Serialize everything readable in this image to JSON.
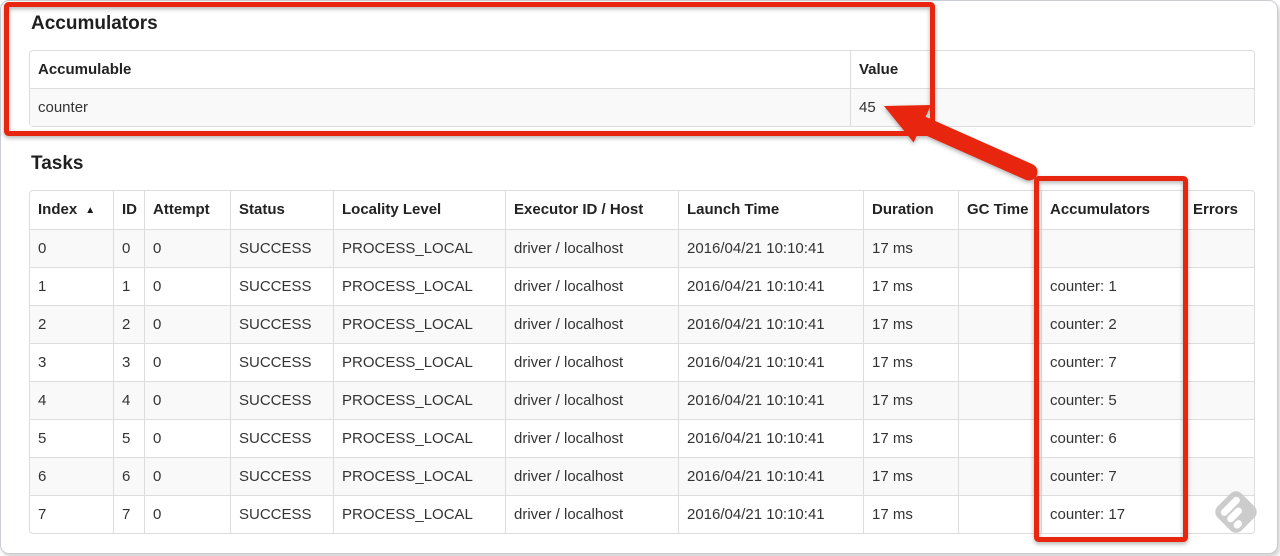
{
  "accumulators": {
    "title": "Accumulators",
    "columns": [
      {
        "label": "Accumulable"
      },
      {
        "label": "Value"
      }
    ],
    "rows": [
      {
        "accumulable": "counter",
        "value": "45"
      }
    ]
  },
  "tasks": {
    "title": "Tasks",
    "columns": [
      {
        "label": "Index",
        "sorted": "ascending"
      },
      {
        "label": "ID"
      },
      {
        "label": "Attempt"
      },
      {
        "label": "Status"
      },
      {
        "label": "Locality Level"
      },
      {
        "label": "Executor ID / Host"
      },
      {
        "label": "Launch Time"
      },
      {
        "label": "Duration"
      },
      {
        "label": "GC Time"
      },
      {
        "label": "Accumulators"
      },
      {
        "label": "Errors"
      }
    ],
    "rows": [
      {
        "index": "0",
        "id": "0",
        "attempt": "0",
        "status": "SUCCESS",
        "locality_level": "PROCESS_LOCAL",
        "executor_id_host": "driver / localhost",
        "launch_time": "2016/04/21 10:10:41",
        "duration": "17 ms",
        "gc_time": "",
        "accumulators": "",
        "errors": ""
      },
      {
        "index": "1",
        "id": "1",
        "attempt": "0",
        "status": "SUCCESS",
        "locality_level": "PROCESS_LOCAL",
        "executor_id_host": "driver / localhost",
        "launch_time": "2016/04/21 10:10:41",
        "duration": "17 ms",
        "gc_time": "",
        "accumulators": "counter: 1",
        "errors": ""
      },
      {
        "index": "2",
        "id": "2",
        "attempt": "0",
        "status": "SUCCESS",
        "locality_level": "PROCESS_LOCAL",
        "executor_id_host": "driver / localhost",
        "launch_time": "2016/04/21 10:10:41",
        "duration": "17 ms",
        "gc_time": "",
        "accumulators": "counter: 2",
        "errors": ""
      },
      {
        "index": "3",
        "id": "3",
        "attempt": "0",
        "status": "SUCCESS",
        "locality_level": "PROCESS_LOCAL",
        "executor_id_host": "driver / localhost",
        "launch_time": "2016/04/21 10:10:41",
        "duration": "17 ms",
        "gc_time": "",
        "accumulators": "counter: 7",
        "errors": ""
      },
      {
        "index": "4",
        "id": "4",
        "attempt": "0",
        "status": "SUCCESS",
        "locality_level": "PROCESS_LOCAL",
        "executor_id_host": "driver / localhost",
        "launch_time": "2016/04/21 10:10:41",
        "duration": "17 ms",
        "gc_time": "",
        "accumulators": "counter: 5",
        "errors": ""
      },
      {
        "index": "5",
        "id": "5",
        "attempt": "0",
        "status": "SUCCESS",
        "locality_level": "PROCESS_LOCAL",
        "executor_id_host": "driver / localhost",
        "launch_time": "2016/04/21 10:10:41",
        "duration": "17 ms",
        "gc_time": "",
        "accumulators": "counter: 6",
        "errors": ""
      },
      {
        "index": "6",
        "id": "6",
        "attempt": "0",
        "status": "SUCCESS",
        "locality_level": "PROCESS_LOCAL",
        "executor_id_host": "driver / localhost",
        "launch_time": "2016/04/21 10:10:41",
        "duration": "17 ms",
        "gc_time": "",
        "accumulators": "counter: 7",
        "errors": ""
      },
      {
        "index": "7",
        "id": "7",
        "attempt": "0",
        "status": "SUCCESS",
        "locality_level": "PROCESS_LOCAL",
        "executor_id_host": "driver / localhost",
        "launch_time": "2016/04/21 10:10:41",
        "duration": "17 ms",
        "gc_time": "",
        "accumulators": "counter: 17",
        "errors": ""
      }
    ]
  },
  "icons": {
    "sort_ascending": "▲"
  },
  "annotations": {
    "highlight_color": "#e8250e",
    "watermark_color": "#c8c8c8"
  }
}
